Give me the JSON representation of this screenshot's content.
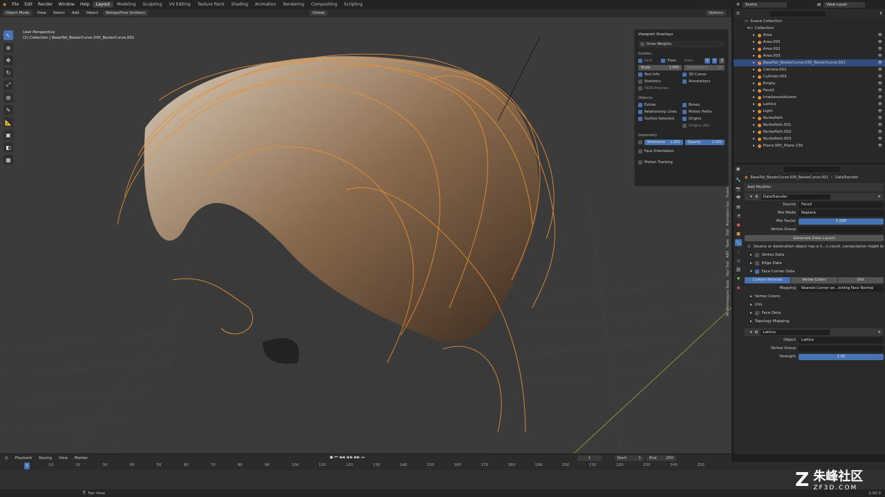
{
  "topbar": {
    "menu": [
      "File",
      "Edit",
      "Render",
      "Window",
      "Help"
    ],
    "workspaces": [
      "Layout",
      "Modeling",
      "Sculpting",
      "UV Editing",
      "Texture Paint",
      "Shading",
      "Animation",
      "Rendering",
      "Compositing",
      "Scripting"
    ],
    "active_workspace": "Layout",
    "scene": "Scene",
    "view_layer": "View Layer"
  },
  "viewport_header": {
    "mode": "Object Mode",
    "menus": [
      "View",
      "Select",
      "Add",
      "Object"
    ],
    "retopo": "RetopoFlow (broken)",
    "transform": "Global",
    "options": "Options"
  },
  "viewport_info": {
    "line1": "User Perspective",
    "line2": "(1) Collection | BaseTail_BezierCurve.030_BezierCurve.001"
  },
  "overlays": {
    "title": "Viewport Overlays",
    "draw_weights": "Draw Weights",
    "guides_label": "Guides",
    "grid": "Grid",
    "floor": "Floor",
    "axes": "Axes",
    "axis_x": "X",
    "axis_y": "Y",
    "axis_z": "Z",
    "scale_label": "Scale",
    "scale_value": "1.000",
    "subdivisions_label": "Subdivisions",
    "subdivisions_value": "10",
    "text_info": "Text Info",
    "cursor_3d": "3D Cursor",
    "statistics": "Statistics",
    "annotations": "Annotations",
    "hdri_preview": "HDRI Preview",
    "objects_label": "Objects",
    "extras": "Extras",
    "bones": "Bones",
    "relationship_lines": "Relationship Lines",
    "motion_paths": "Motion Paths",
    "outline_selected": "Outline Selected",
    "origins": "Origins",
    "origins_all": "Origins (All)",
    "geometry_label": "Geometry",
    "wireframe_label": "Wireframe",
    "wireframe_value": "1.000",
    "opacity_label": "Opacity",
    "opacity_value": "1.000",
    "face_orientation": "Face Orientation",
    "motion_tracking": "Motion Tracking"
  },
  "outliner": {
    "root": "Scene Collection",
    "collection": "Collection",
    "items": [
      {
        "name": "Area",
        "selected": false
      },
      {
        "name": "Area.001",
        "selected": false
      },
      {
        "name": "Area.002",
        "selected": false
      },
      {
        "name": "Area.003",
        "selected": false
      },
      {
        "name": "BaseTail_BezierCurve.030_BezierCurve.001",
        "selected": true
      },
      {
        "name": "Camera.001",
        "selected": false
      },
      {
        "name": "Cylinder.001",
        "selected": false
      },
      {
        "name": "Empty",
        "selected": false
      },
      {
        "name": "Face2",
        "selected": false
      },
      {
        "name": "IrradianceVolume",
        "selected": false
      },
      {
        "name": "Lattice",
        "selected": false
      },
      {
        "name": "Light",
        "selected": false
      },
      {
        "name": "NurbsPath",
        "selected": false
      },
      {
        "name": "NurbsPath.001",
        "selected": false
      },
      {
        "name": "NurbsPath.002",
        "selected": false
      },
      {
        "name": "NurbsPath.003",
        "selected": false
      },
      {
        "name": "Plane.065_Plane.136",
        "selected": false
      }
    ]
  },
  "properties": {
    "breadcrumb_obj": "BaseTail_BezierCurve.030_BezierCurve.001",
    "breadcrumb_mod": "DataTransfer",
    "add_modifier": "Add Modifier",
    "mod1_name": "DataTransfer",
    "source_label": "Source",
    "source_value": "Face2",
    "mix_mode_label": "Mix Mode",
    "mix_mode_value": "Replace",
    "mix_factor_label": "Mix Factor",
    "mix_factor_value": "1.000",
    "vertex_group_label": "Vertex Group",
    "generate_btn": "Generate Data Layers",
    "warning": "Source or destination object has a h...n count, computation might be slow",
    "vertex_data": "Vertex Data",
    "edge_data": "Edge Data",
    "face_corner_data": "Face Corner Data",
    "seg_custom_normals": "Custom Normals",
    "seg_vertex_colors": "Vertex Colors",
    "seg_uvs": "UVs",
    "mapping_label": "Mapping",
    "mapping_value": "Nearest Corner an...tching Face Normal",
    "sub_vertex_colors": "Vertex Colors",
    "sub_uvs": "UVs",
    "face_data": "Face Data",
    "topology_mapping": "Topology Mapping",
    "mod2_name": "Lattice",
    "object_label": "Object",
    "object_value": "Lattice",
    "vertex_group2_label": "Vertex Group",
    "strength_label": "Strength",
    "strength_value": "1.00"
  },
  "side_tabs": [
    "Fluent",
    "Animation Sys",
    "Edit",
    "Tools",
    "ARP",
    "Hair Tool",
    "Mr Mannequins Tools"
  ],
  "timeline": {
    "menus": [
      "Playback",
      "Keying",
      "View",
      "Marker"
    ],
    "current_frame": "1",
    "start_label": "Start",
    "start_value": "1",
    "end_label": "End",
    "end_value": "250",
    "playhead": "1",
    "ticks": [
      "10",
      "20",
      "30",
      "40",
      "50",
      "60",
      "70",
      "80",
      "90",
      "100",
      "110",
      "120",
      "130",
      "140",
      "150",
      "160",
      "170",
      "180",
      "190",
      "200",
      "210",
      "220",
      "230",
      "240",
      "250"
    ]
  },
  "status": {
    "left": "Pan View",
    "version": "2.92.0"
  },
  "watermark": {
    "cn": "朱峰社区",
    "en": "ZF3D.COM"
  },
  "colors": {
    "accent": "#4772b3",
    "selection_outline": "#e69035",
    "viewport_bg": "#3b3b3b"
  }
}
